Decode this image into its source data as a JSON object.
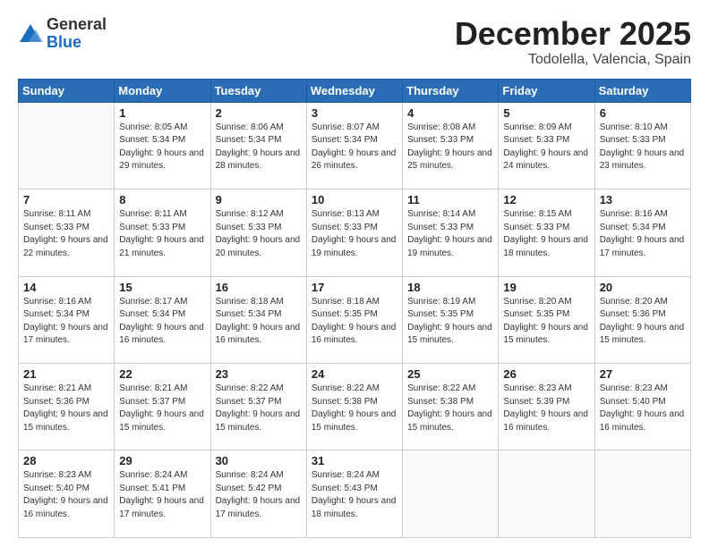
{
  "logo": {
    "general": "General",
    "blue": "Blue"
  },
  "header": {
    "month": "December 2025",
    "location": "Todolella, Valencia, Spain"
  },
  "weekdays": [
    "Sunday",
    "Monday",
    "Tuesday",
    "Wednesday",
    "Thursday",
    "Friday",
    "Saturday"
  ],
  "weeks": [
    [
      {
        "day": "",
        "info": ""
      },
      {
        "day": "1",
        "info": "Sunrise: 8:05 AM\nSunset: 5:34 PM\nDaylight: 9 hours\nand 29 minutes."
      },
      {
        "day": "2",
        "info": "Sunrise: 8:06 AM\nSunset: 5:34 PM\nDaylight: 9 hours\nand 28 minutes."
      },
      {
        "day": "3",
        "info": "Sunrise: 8:07 AM\nSunset: 5:34 PM\nDaylight: 9 hours\nand 26 minutes."
      },
      {
        "day": "4",
        "info": "Sunrise: 8:08 AM\nSunset: 5:33 PM\nDaylight: 9 hours\nand 25 minutes."
      },
      {
        "day": "5",
        "info": "Sunrise: 8:09 AM\nSunset: 5:33 PM\nDaylight: 9 hours\nand 24 minutes."
      },
      {
        "day": "6",
        "info": "Sunrise: 8:10 AM\nSunset: 5:33 PM\nDaylight: 9 hours\nand 23 minutes."
      }
    ],
    [
      {
        "day": "7",
        "info": "Sunrise: 8:11 AM\nSunset: 5:33 PM\nDaylight: 9 hours\nand 22 minutes."
      },
      {
        "day": "8",
        "info": "Sunrise: 8:11 AM\nSunset: 5:33 PM\nDaylight: 9 hours\nand 21 minutes."
      },
      {
        "day": "9",
        "info": "Sunrise: 8:12 AM\nSunset: 5:33 PM\nDaylight: 9 hours\nand 20 minutes."
      },
      {
        "day": "10",
        "info": "Sunrise: 8:13 AM\nSunset: 5:33 PM\nDaylight: 9 hours\nand 19 minutes."
      },
      {
        "day": "11",
        "info": "Sunrise: 8:14 AM\nSunset: 5:33 PM\nDaylight: 9 hours\nand 19 minutes."
      },
      {
        "day": "12",
        "info": "Sunrise: 8:15 AM\nSunset: 5:33 PM\nDaylight: 9 hours\nand 18 minutes."
      },
      {
        "day": "13",
        "info": "Sunrise: 8:16 AM\nSunset: 5:34 PM\nDaylight: 9 hours\nand 17 minutes."
      }
    ],
    [
      {
        "day": "14",
        "info": "Sunrise: 8:16 AM\nSunset: 5:34 PM\nDaylight: 9 hours\nand 17 minutes."
      },
      {
        "day": "15",
        "info": "Sunrise: 8:17 AM\nSunset: 5:34 PM\nDaylight: 9 hours\nand 16 minutes."
      },
      {
        "day": "16",
        "info": "Sunrise: 8:18 AM\nSunset: 5:34 PM\nDaylight: 9 hours\nand 16 minutes."
      },
      {
        "day": "17",
        "info": "Sunrise: 8:18 AM\nSunset: 5:35 PM\nDaylight: 9 hours\nand 16 minutes."
      },
      {
        "day": "18",
        "info": "Sunrise: 8:19 AM\nSunset: 5:35 PM\nDaylight: 9 hours\nand 15 minutes."
      },
      {
        "day": "19",
        "info": "Sunrise: 8:20 AM\nSunset: 5:35 PM\nDaylight: 9 hours\nand 15 minutes."
      },
      {
        "day": "20",
        "info": "Sunrise: 8:20 AM\nSunset: 5:36 PM\nDaylight: 9 hours\nand 15 minutes."
      }
    ],
    [
      {
        "day": "21",
        "info": "Sunrise: 8:21 AM\nSunset: 5:36 PM\nDaylight: 9 hours\nand 15 minutes."
      },
      {
        "day": "22",
        "info": "Sunrise: 8:21 AM\nSunset: 5:37 PM\nDaylight: 9 hours\nand 15 minutes."
      },
      {
        "day": "23",
        "info": "Sunrise: 8:22 AM\nSunset: 5:37 PM\nDaylight: 9 hours\nand 15 minutes."
      },
      {
        "day": "24",
        "info": "Sunrise: 8:22 AM\nSunset: 5:38 PM\nDaylight: 9 hours\nand 15 minutes."
      },
      {
        "day": "25",
        "info": "Sunrise: 8:22 AM\nSunset: 5:38 PM\nDaylight: 9 hours\nand 15 minutes."
      },
      {
        "day": "26",
        "info": "Sunrise: 8:23 AM\nSunset: 5:39 PM\nDaylight: 9 hours\nand 16 minutes."
      },
      {
        "day": "27",
        "info": "Sunrise: 8:23 AM\nSunset: 5:40 PM\nDaylight: 9 hours\nand 16 minutes."
      }
    ],
    [
      {
        "day": "28",
        "info": "Sunrise: 8:23 AM\nSunset: 5:40 PM\nDaylight: 9 hours\nand 16 minutes."
      },
      {
        "day": "29",
        "info": "Sunrise: 8:24 AM\nSunset: 5:41 PM\nDaylight: 9 hours\nand 17 minutes."
      },
      {
        "day": "30",
        "info": "Sunrise: 8:24 AM\nSunset: 5:42 PM\nDaylight: 9 hours\nand 17 minutes."
      },
      {
        "day": "31",
        "info": "Sunrise: 8:24 AM\nSunset: 5:43 PM\nDaylight: 9 hours\nand 18 minutes."
      },
      {
        "day": "",
        "info": ""
      },
      {
        "day": "",
        "info": ""
      },
      {
        "day": "",
        "info": ""
      }
    ]
  ]
}
